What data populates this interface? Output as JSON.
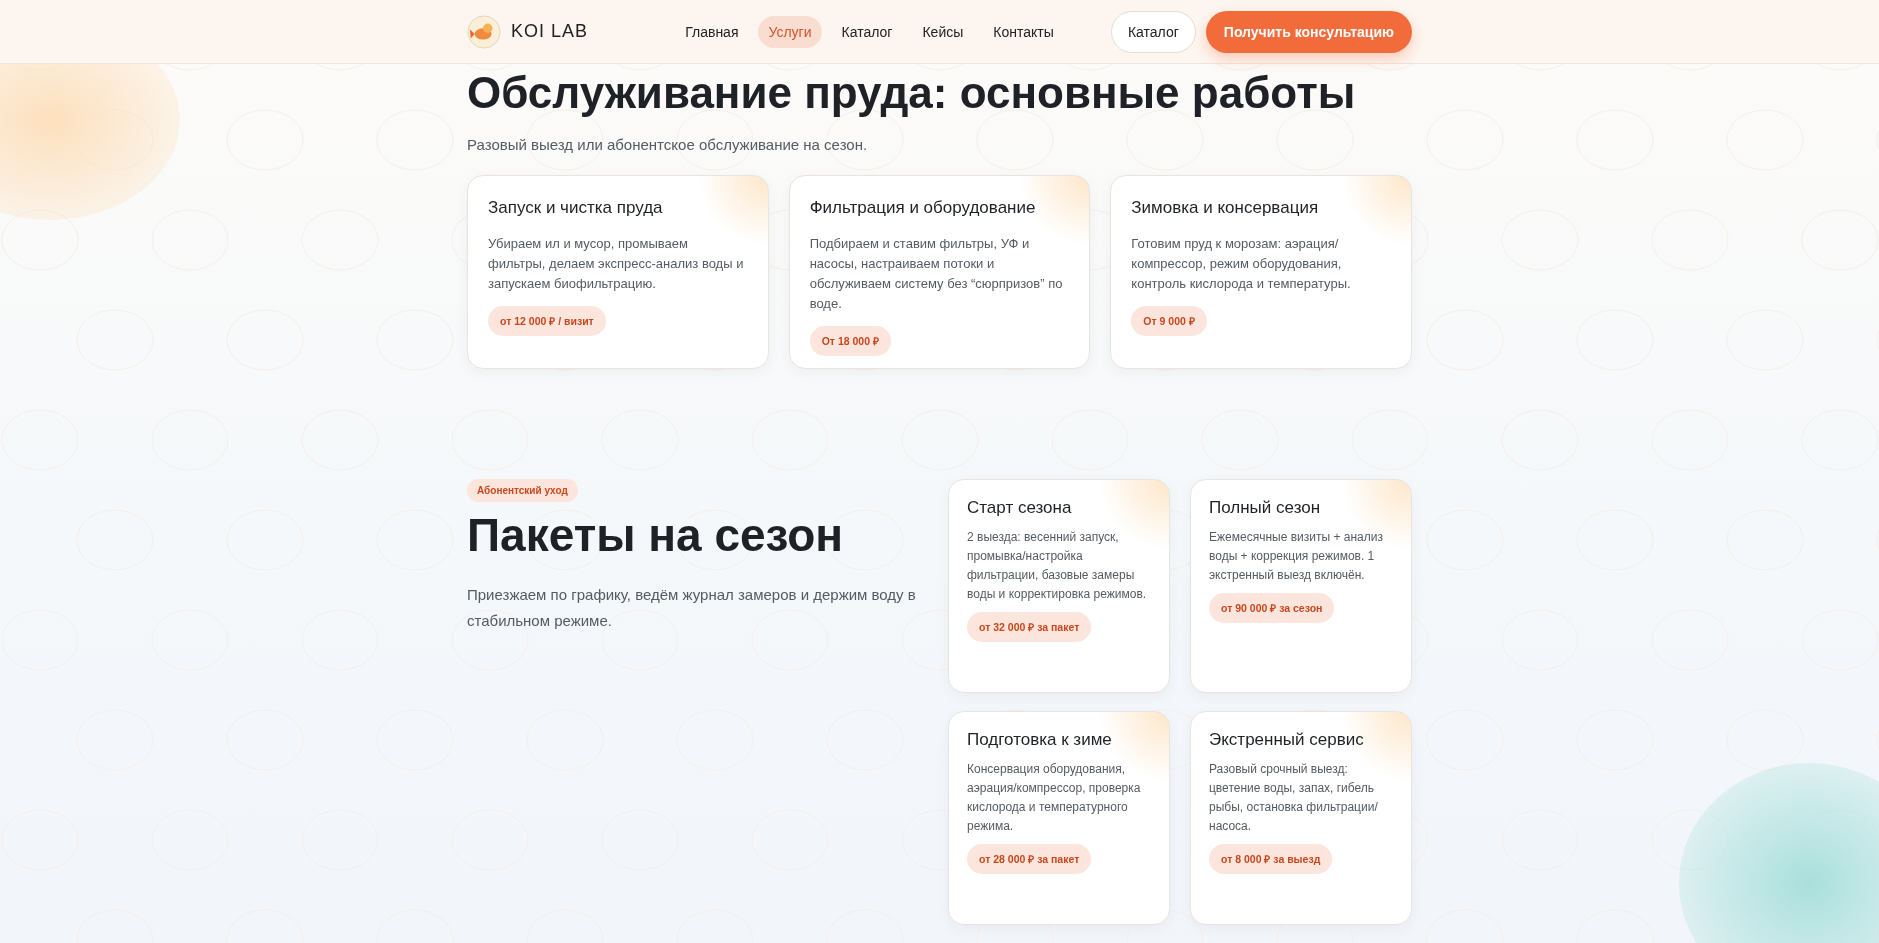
{
  "header": {
    "brand": "KOI LAB",
    "nav": [
      {
        "label": "Главная",
        "selected": false
      },
      {
        "label": "Услуги",
        "selected": true
      },
      {
        "label": "Каталог",
        "selected": false
      },
      {
        "label": "Кейсы",
        "selected": false
      },
      {
        "label": "Контакты",
        "selected": false
      }
    ],
    "secondary_button": "Каталог",
    "primary_button": "Получить консультацию"
  },
  "services": {
    "title": "Обслуживание пруда: основные работы",
    "subtitle": "Разовый выезд или абонентское обслуживание на сезон.",
    "cards": [
      {
        "title": "Запуск и чистка пруда",
        "text": "Убираем ил и мусор, промываем фильтры, делаем экспресс-анализ воды и запускаем биофильтрацию.",
        "price": "от 12 000 ₽ / визит"
      },
      {
        "title": "Фильтрация и оборудование",
        "text": "Подбираем и ставим фильтры, УФ и насосы, настраиваем потоки и обслуживаем систему без “сюрпризов” по воде.",
        "price": "От 18 000 ₽"
      },
      {
        "title": "Зимовка и консервация",
        "text": "Готовим пруд к морозам: аэрация/компрессор, режим оборудования, контроль кислорода и температуры.",
        "price": "От 9 000 ₽"
      }
    ]
  },
  "packages": {
    "badge": "Абонентский уход",
    "title": "Пакеты на сезон",
    "text": "Приезжаем по графику, ведём журнал замеров и держим воду в стабильном режиме.",
    "cards": [
      {
        "title": "Старт сезона",
        "text": "2 выезда: весенний запуск, промывка/настройка фильтрации, базовые замеры воды и корректировка режимов.",
        "price": "от 32 000 ₽ за пакет"
      },
      {
        "title": "Полный сезон",
        "text": "Ежемесячные визиты + анализ воды + коррекция режимов. 1 экстренный выезд включён.",
        "price": "от 90 000 ₽ за сезон"
      },
      {
        "title": "Подготовка к зиме",
        "text": "Консервация оборудования, аэрация/компрессор, проверка кислорода и температурного режима.",
        "price": "от 28 000 ₽ за пакет"
      },
      {
        "title": "Экстренный сервис",
        "text": "Разовый срочный выезд: цветение воды, запах, гибель рыбы, остановка фильтрации/насоса.",
        "price": "от 8 000 ₽ за выезд"
      }
    ]
  }
}
